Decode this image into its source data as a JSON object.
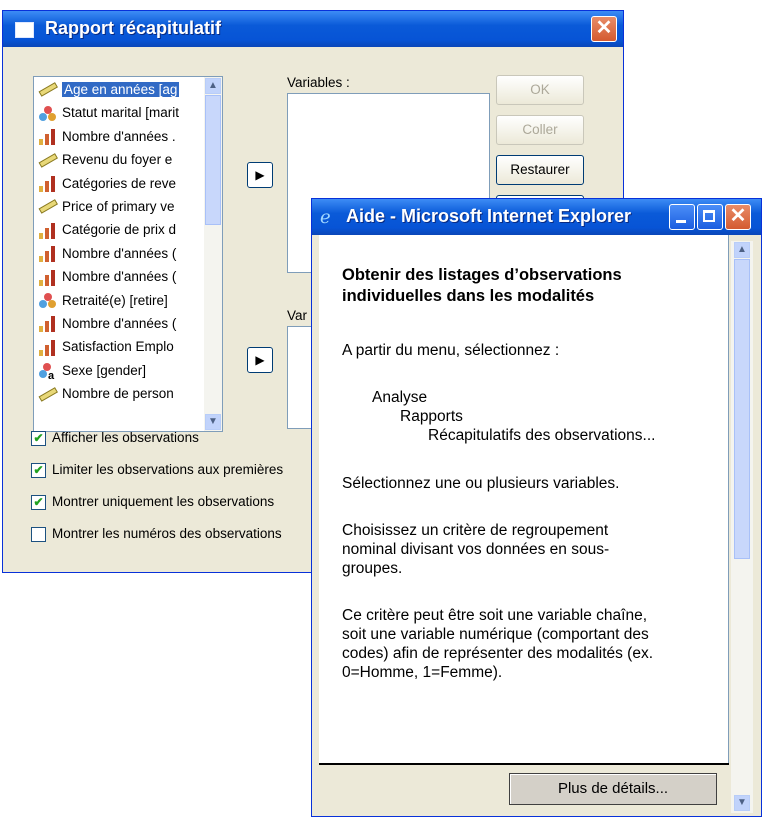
{
  "dialog": {
    "title": "Rapport récapitulatif",
    "title_icon": "window-icon",
    "close_label": "✕",
    "variable_list": [
      {
        "label": "Age en années [ag",
        "type": "scale",
        "selected": true
      },
      {
        "label": "Statut marital [marit",
        "type": "nominal"
      },
      {
        "label": "Nombre d'années .",
        "type": "ordinal"
      },
      {
        "label": "Revenu du foyer e",
        "type": "scale"
      },
      {
        "label": "Catégories de reve",
        "type": "ordinal"
      },
      {
        "label": "Price of primary ve",
        "type": "scale"
      },
      {
        "label": "Catégorie de prix d",
        "type": "ordinal"
      },
      {
        "label": "Nombre d'années (",
        "type": "ordinal"
      },
      {
        "label": "Nombre d'années (",
        "type": "ordinal"
      },
      {
        "label": "Retraité(e) [retire]",
        "type": "nominal"
      },
      {
        "label": "Nombre d'années (",
        "type": "ordinal"
      },
      {
        "label": "Satisfaction Emplo",
        "type": "ordinal"
      },
      {
        "label": "Sexe [gender]",
        "type": "nominal-string"
      },
      {
        "label": "Nombre de person",
        "type": "scale"
      }
    ],
    "variables_label": "Variables :",
    "grouping_label_partial": "Var",
    "buttons": {
      "ok": "OK",
      "paste": "Coller",
      "reset": "Restaurer"
    },
    "checkboxes": [
      {
        "label": "Afficher les observations",
        "checked": true
      },
      {
        "label": "Limiter les observations aux premières",
        "checked": true
      },
      {
        "label": "Montrer uniquement les observations",
        "checked": true
      },
      {
        "label": "Montrer les numéros des observations",
        "checked": false
      }
    ]
  },
  "help_window": {
    "title": "Aide - Microsoft Internet Explorer",
    "heading_line1": "Obtenir des listages d’observations",
    "heading_line2": "individuelles dans les modalités",
    "p1": "A partir du menu, sélectionnez :",
    "menu_path": [
      "Analyse",
      "Rapports",
      "Récapitulatifs des observations..."
    ],
    "p2": "Sélectionnez une ou plusieurs variables.",
    "p3_lines": [
      "Choisissez un critère de regroupement",
      "nominal divisant vos données en sous-",
      "groupes."
    ],
    "p4_lines": [
      "Ce critère peut être soit une variable chaîne,",
      "soit une variable numérique (comportant des",
      "codes) afin de représenter des modalités (ex.",
      "0=Homme, 1=Femme)."
    ],
    "more_button": "Plus de détails..."
  },
  "colors": {
    "titlebar": "#0a5ad8",
    "dialog_bg": "#ece9d8",
    "selection": "#316ac5"
  }
}
